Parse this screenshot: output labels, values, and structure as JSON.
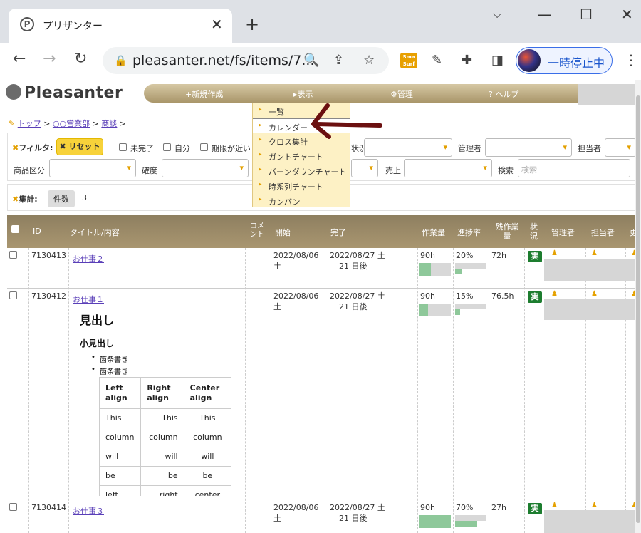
{
  "browser": {
    "tab_title": "プリザンター",
    "favicon": "P",
    "url": "pleasanter.net/fs/items/7...",
    "profile_label": "一時停止中",
    "ext_smart": "Sma\nSurf"
  },
  "app": {
    "logo": "Pleasanter",
    "nav": {
      "new": "+新規作成",
      "view": "▸表示",
      "admin": "⚙管理",
      "help": "? ヘルプ"
    },
    "view_menu": [
      "一覧",
      "カレンダー",
      "クロス集計",
      "ガントチャート",
      "バーンダウンチャート",
      "時系列チャート",
      "カンバン"
    ],
    "view_menu_selected": 1,
    "breadcrumb": [
      "トップ",
      "○○営業部",
      "商談"
    ],
    "filter": {
      "label": "フィルタ:",
      "reset": "✖ リセット",
      "incomplete": "未完了",
      "self": "自分",
      "near_due": "期限が近い",
      "status": "状況",
      "manager": "管理者",
      "owner": "担当者",
      "product_class": "商品区分",
      "certainty": "確度",
      "sales": "売上",
      "search": "検索",
      "search_placeholder": "検索"
    },
    "aggregate": {
      "label": "集計:",
      "tag": "件数",
      "count": "3"
    },
    "columns": {
      "id": "ID",
      "title": "タイトル/内容",
      "comment": "コメント",
      "start": "開始",
      "end": "完了",
      "work": "作業量",
      "progress": "進捗率",
      "remaining": "残作業量",
      "status": "状況",
      "manager": "管理者",
      "owner": "担当者",
      "next": "更"
    },
    "rows": [
      {
        "id": "7130413",
        "title": "お仕事２",
        "start": "2022/08/06 土",
        "end": "2022/08/27 土",
        "end_note": "21 日後",
        "work": "90h",
        "progress": "20%",
        "remaining": "72h",
        "status": "実"
      },
      {
        "id": "7130412",
        "title": "お仕事１",
        "start": "2022/08/06 土",
        "end": "2022/08/27 土",
        "end_note": "21 日後",
        "work": "90h",
        "progress": "15%",
        "remaining": "76.5h",
        "status": "実"
      },
      {
        "id": "7130414",
        "title": "お仕事３",
        "start": "2022/08/06 土",
        "end": "2022/08/27 土",
        "end_note": "21 日後",
        "work": "90h",
        "progress": "70%",
        "remaining": "27h",
        "status": "実"
      }
    ],
    "body": {
      "heading": "見出し",
      "subheading": "小見出し",
      "bullets": [
        "箇条書き",
        "箇条書き"
      ],
      "table_head": [
        "Left align",
        "Right align",
        "Center align"
      ],
      "table_rows": [
        [
          "This",
          "This",
          "This"
        ],
        [
          "column",
          "column",
          "column"
        ],
        [
          "will",
          "will",
          "will"
        ],
        [
          "be",
          "be",
          "be"
        ],
        [
          "left",
          "right",
          "center"
        ]
      ]
    }
  },
  "colors": {
    "nav_bar": "#a9966a",
    "reset_button": "#f7d23a",
    "menu_bg": "#fdf1c5",
    "status_green": "#1d7d2f",
    "progress_green": "#8ec89a",
    "annotation_arrow": "#6b1010"
  }
}
